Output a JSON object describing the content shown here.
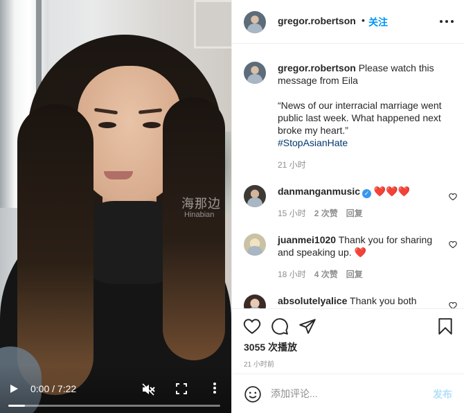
{
  "video": {
    "watermark_line1": "海那边",
    "watermark_line2": "Hinabian",
    "time_display": "0:00 / 7:22",
    "progress_fraction": 0.08,
    "icons": {
      "play": "play-icon",
      "mute": "volume-muted-icon",
      "fullscreen": "fullscreen-icon",
      "more": "more-vertical-icon"
    }
  },
  "header": {
    "username": "gregor.robertson",
    "separator": "•",
    "follow_label": "关注"
  },
  "caption": {
    "username": "gregor.robertson",
    "text1": "Please watch this message from Eila",
    "text2": "“News of our interracial marriage went public last week. What happened next broke my heart.”",
    "hashtag": "#StopAsianHate",
    "time": "21 小时"
  },
  "comments": [
    {
      "username": "danmanganmusic",
      "verified": true,
      "text": "❤️❤️❤️",
      "time": "15 小时",
      "likes": "2 次赞",
      "reply": "回复"
    },
    {
      "username": "juanmei1020",
      "verified": false,
      "text": "Thank you for sharing and speaking up. ❤️",
      "time": "18 小时",
      "likes": "4 次赞",
      "reply": "回复"
    },
    {
      "username": "absolutelyalice",
      "verified": false,
      "text": "Thank you both"
    }
  ],
  "actions": {
    "play_count": "3055 次播放",
    "posted_time": "21 小时前"
  },
  "composer": {
    "placeholder": "添加评论...",
    "post_label": "发布"
  },
  "colors": {
    "link_blue": "#0095f6",
    "post_disabled": "#b2dffc",
    "secondary_text": "#8e8e8e",
    "hashtag": "#00376b"
  }
}
